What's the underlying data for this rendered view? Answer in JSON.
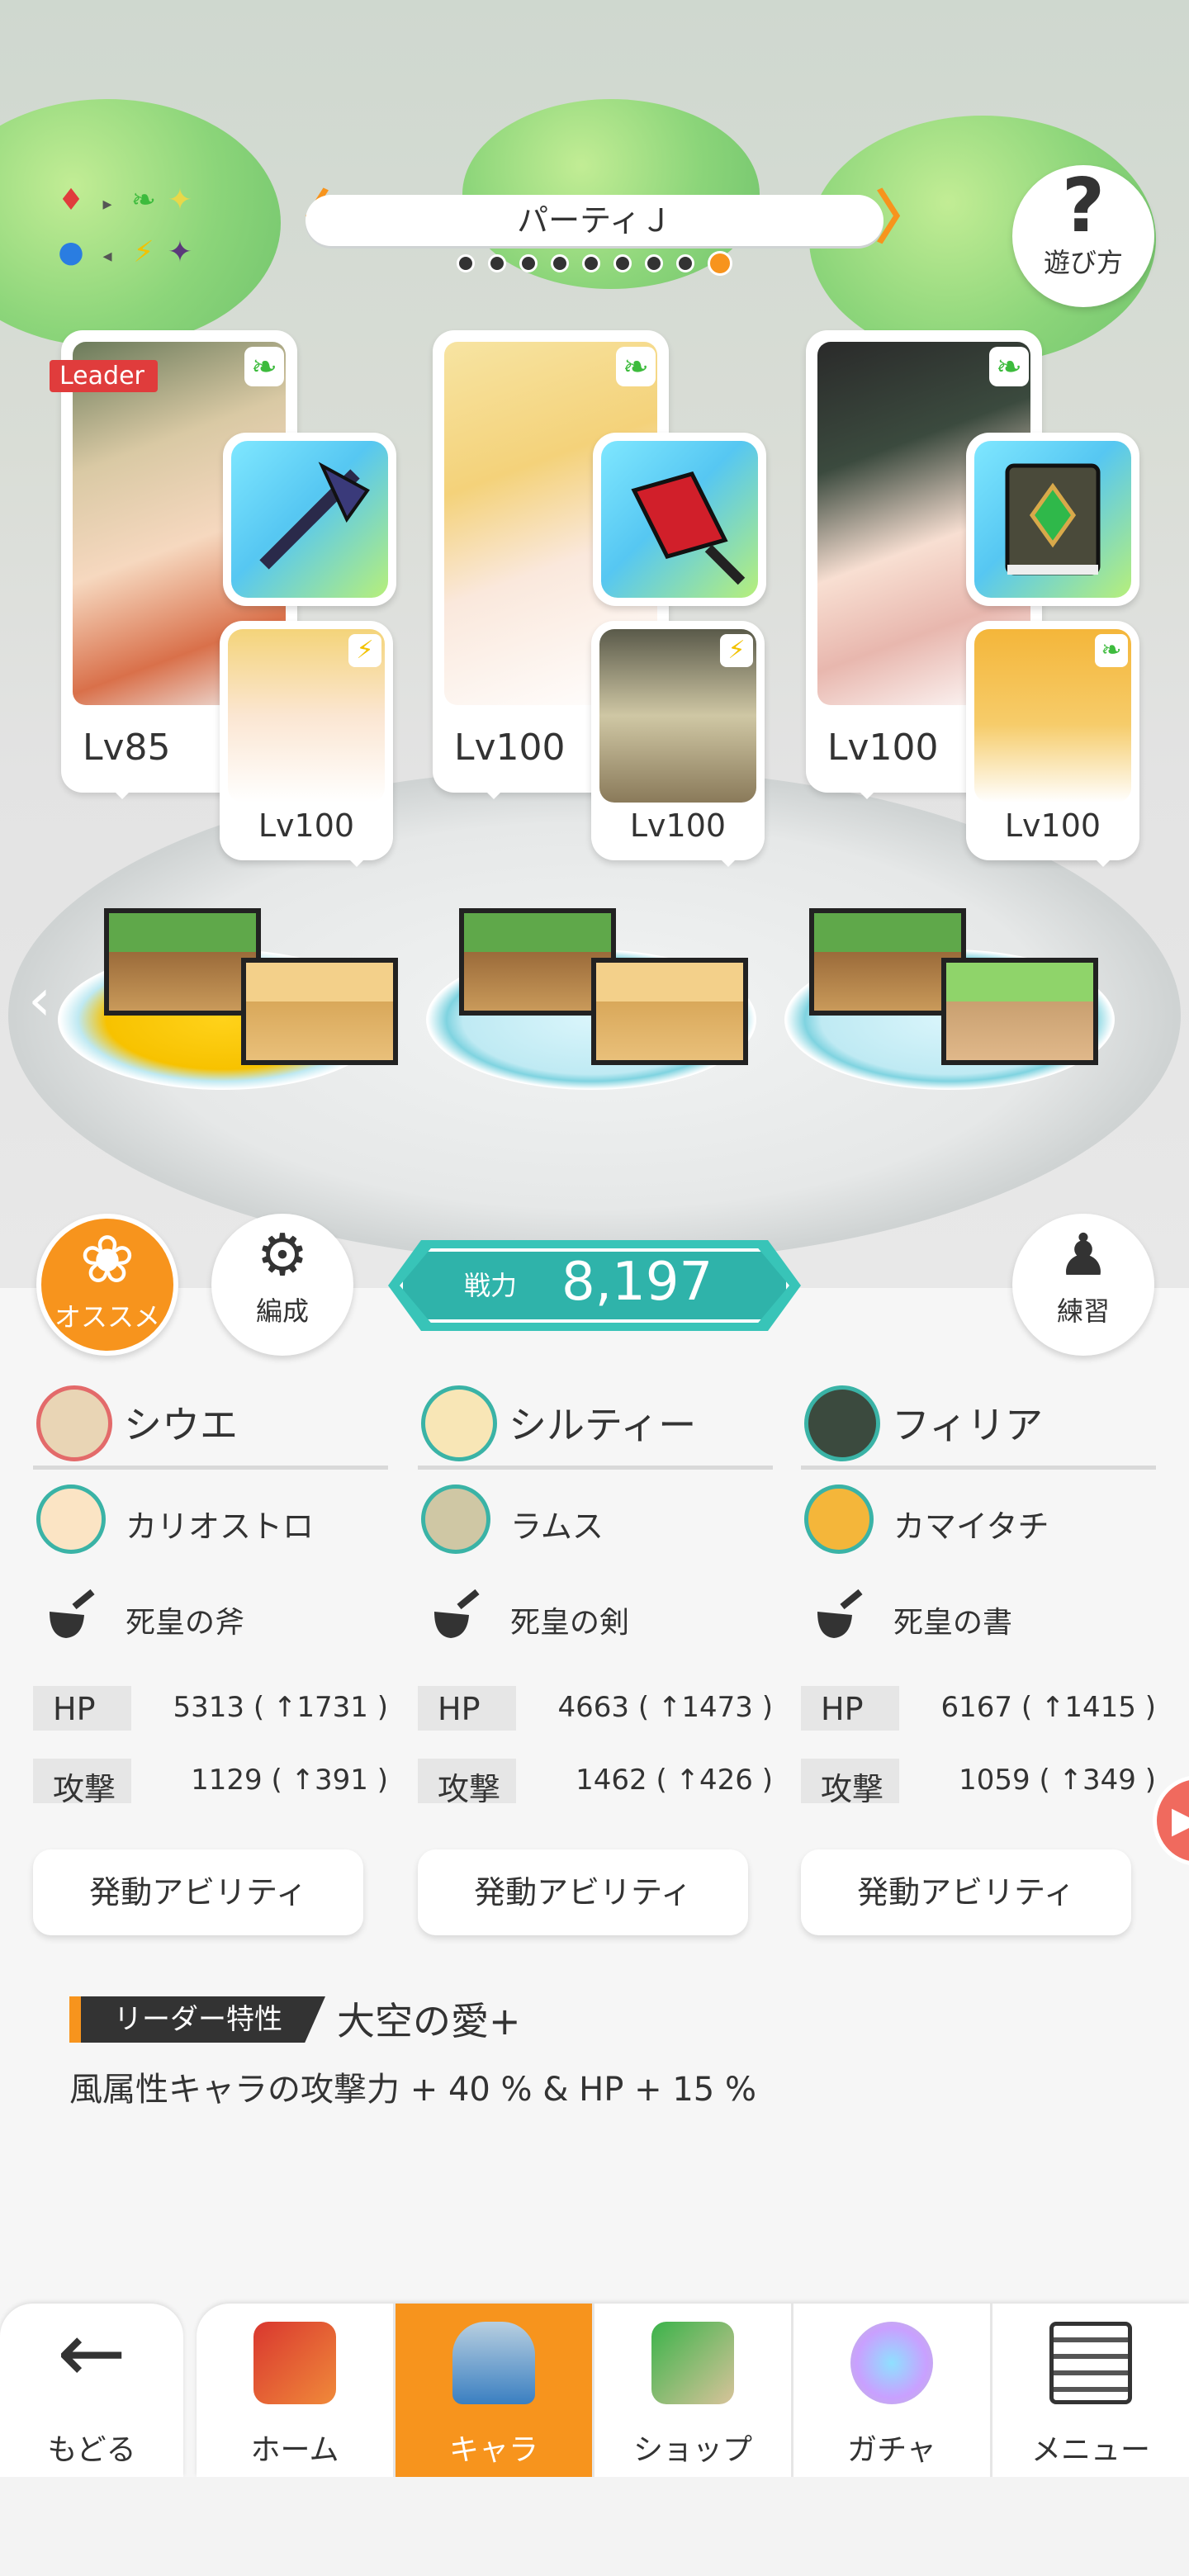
{
  "party": {
    "title": "パーティＪ",
    "prev_arrow": "〈",
    "next_arrow": "〉",
    "page_count": 9,
    "active_page": 9
  },
  "element_chart": {
    "symbols": [
      "♦",
      "▸",
      "❧",
      "✦",
      "●",
      "◂",
      "⚡",
      "✦"
    ]
  },
  "help_button": {
    "glyph": "?",
    "label": "遊び方"
  },
  "cards": [
    {
      "level": "Lv85",
      "leader_badge": "Leader",
      "element": "wind",
      "element_icon": "❧",
      "weapon_icon": "axe",
      "sub": {
        "level": "Lv100",
        "element": "thunder",
        "element_icon": "⚡"
      }
    },
    {
      "level": "Lv100",
      "element": "wind",
      "element_icon": "❧",
      "weapon_icon": "sword",
      "sub": {
        "level": "Lv100",
        "element": "thunder",
        "element_icon": "⚡"
      }
    },
    {
      "level": "Lv100",
      "element": "wind",
      "element_icon": "❧",
      "weapon_icon": "book",
      "sub": {
        "level": "Lv100",
        "element": "wind",
        "element_icon": "❧"
      }
    }
  ],
  "controls": {
    "recommend_label": "オススメ",
    "formation_label": "編成",
    "practice_label": "練習",
    "power_label": "戦力",
    "power_value": "8,197"
  },
  "columns": [
    {
      "name": "シウエ",
      "sub_name": "カリオストロ",
      "equip": "死皇の斧",
      "hp_label": "HP",
      "hp_value": "5313 ( ↑1731 )",
      "atk_label": "攻撃",
      "atk_value": "1129 ( ↑391 )",
      "ability_button": "発動アビリティ"
    },
    {
      "name": "シルティー",
      "sub_name": "ラムス",
      "equip": "死皇の剣",
      "hp_label": "HP",
      "hp_value": "4663 ( ↑1473 )",
      "atk_label": "攻撃",
      "atk_value": "1462 ( ↑426 )",
      "ability_button": "発動アビリティ"
    },
    {
      "name": "フィリア",
      "sub_name": "カマイタチ",
      "equip": "死皇の書",
      "hp_label": "HP",
      "hp_value": "6167 ( ↑1415 )",
      "atk_label": "攻撃",
      "atk_value": "1059 ( ↑349 )",
      "ability_button": "発動アビリティ"
    }
  ],
  "leader_trait": {
    "tag": "リーダー特性",
    "name": "大空の愛+",
    "description": "風属性キャラの攻撃力 + 40 % & HP + 15 %"
  },
  "nav": {
    "back_label": "もどる",
    "items": [
      {
        "label": "ホーム",
        "icon": "home-icon",
        "active": false
      },
      {
        "label": "キャラ",
        "icon": "character-icon",
        "active": true
      },
      {
        "label": "ショップ",
        "icon": "shop-icon",
        "active": false
      },
      {
        "label": "ガチャ",
        "icon": "gacha-icon",
        "active": false
      },
      {
        "label": "メニュー",
        "icon": "menu-icon",
        "active": false
      }
    ]
  },
  "colors": {
    "accent_orange": "#f7941d",
    "power_teal": "#38c4b8",
    "wind_green": "#3dbb3d",
    "thunder_yellow": "#f2c200"
  }
}
